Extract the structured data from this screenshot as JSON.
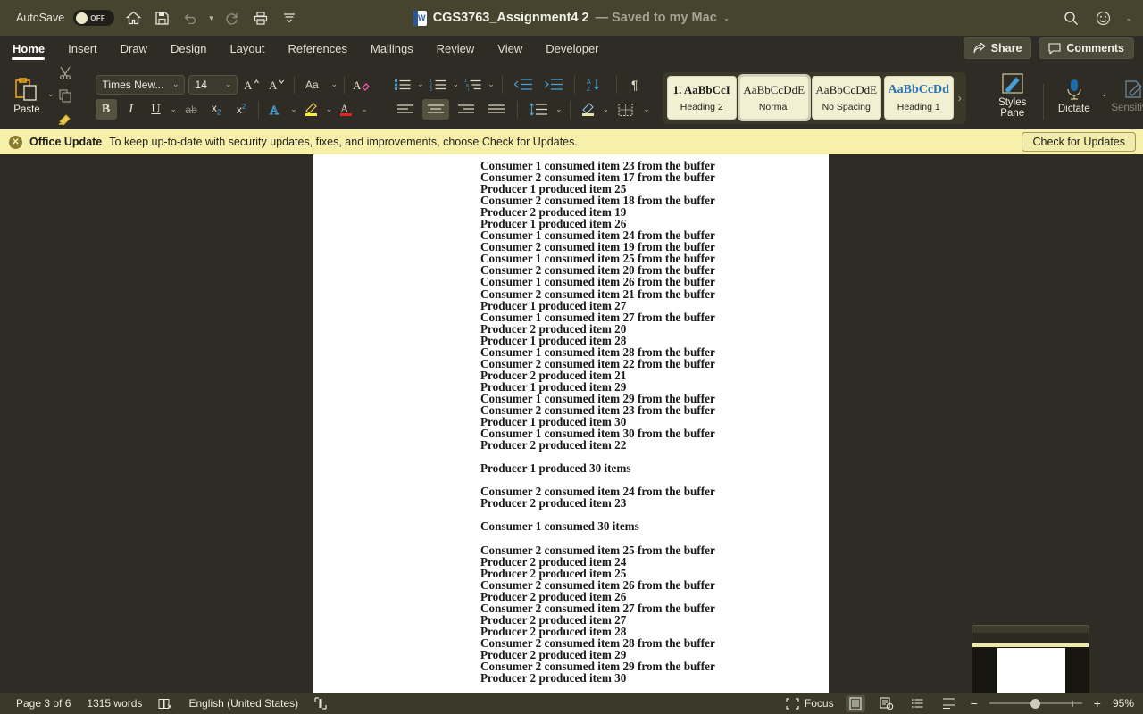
{
  "titlebar": {
    "autosave_label": "AutoSave",
    "autosave_state": "OFF",
    "doc_title": "CGS3763_Assignment4 2",
    "saved_state": "— Saved to my Mac",
    "icons": [
      "home-icon",
      "save-icon",
      "undo-icon",
      "redo-icon",
      "print-icon",
      "customize-toolbar-icon"
    ],
    "search_icon": "search-icon",
    "account_icon": "smiley-face-icon"
  },
  "tabs": [
    {
      "label": "Home",
      "active": true
    },
    {
      "label": "Insert",
      "active": false
    },
    {
      "label": "Draw",
      "active": false
    },
    {
      "label": "Design",
      "active": false
    },
    {
      "label": "Layout",
      "active": false
    },
    {
      "label": "References",
      "active": false
    },
    {
      "label": "Mailings",
      "active": false
    },
    {
      "label": "Review",
      "active": false
    },
    {
      "label": "View",
      "active": false
    },
    {
      "label": "Developer",
      "active": false
    }
  ],
  "tab_actions": {
    "share_label": "Share",
    "comments_label": "Comments"
  },
  "ribbon": {
    "paste_label": "Paste",
    "font_name": "Times New...",
    "font_size": "14",
    "bold_active": true,
    "align_center_active": true,
    "styles": [
      {
        "preview": "1.  AaBbCcI",
        "name": "Heading 2",
        "selected": false,
        "variant": "bold"
      },
      {
        "preview": "AaBbCcDdE",
        "name": "Normal",
        "selected": true,
        "variant": "plain"
      },
      {
        "preview": "AaBbCcDdE",
        "name": "No Spacing",
        "selected": false,
        "variant": "plain"
      },
      {
        "preview": "AaBbCcDd",
        "name": "Heading 1",
        "selected": false,
        "variant": "heading1"
      }
    ],
    "styles_pane_label": "Styles Pane",
    "dictate_label": "Dictate",
    "sensitivity_label": "Sensitivity"
  },
  "notice": {
    "title": "Office Update",
    "message": "To keep up-to-date with security updates, fixes, and improvements, choose Check for Updates.",
    "button_label": "Check for Updates",
    "close_icon": "close-icon",
    "background_color": "#f6f0ab"
  },
  "document": {
    "lines": [
      "Consumer 1 consumed item 23 from the buffer",
      "Consumer 2 consumed item 17 from the buffer",
      "Producer 1 produced item 25",
      "Consumer 2 consumed item 18 from the buffer",
      "Producer 2 produced item 19",
      "Producer 1 produced item 26",
      "Consumer 1 consumed item 24 from the buffer",
      "Consumer 2 consumed item 19 from the buffer",
      "Consumer 1 consumed item 25 from the buffer",
      "Consumer 2 consumed item 20 from the buffer",
      "Consumer 1 consumed item 26 from the buffer",
      "Consumer 2 consumed item 21 from the buffer",
      "Producer 1 produced item 27",
      "Consumer 1 consumed item 27 from the buffer",
      "Producer 2 produced item 20",
      "Producer 1 produced item 28",
      "Consumer 1 consumed item 28 from the buffer",
      "Consumer 2 consumed item 22 from the buffer",
      "Producer 2 produced item 21",
      "Producer 1 produced item 29",
      "Consumer 1 consumed item 29 from the buffer",
      "Consumer 2 consumed item 23 from the buffer",
      "Producer 1 produced item 30",
      "Consumer 1 consumed item 30 from the buffer",
      "Producer 2 produced item 22",
      "",
      "Producer 1 produced 30 items",
      "",
      "Consumer 2 consumed item 24 from the buffer",
      "Producer 2 produced item 23",
      "",
      "Consumer 1 consumed 30 items",
      "",
      "Consumer 2 consumed item 25 from the buffer",
      "Producer 2 produced item 24",
      "Producer 2 produced item 25",
      "Consumer 2 consumed item 26 from the buffer",
      "Producer 2 produced item 26",
      "Consumer 2 consumed item 27 from the buffer",
      "Producer 2 produced item 27",
      "Producer 2 produced item 28",
      "Consumer 2 consumed item 28 from the buffer",
      "Producer 2 produced item 29",
      "Consumer 2 consumed item 29 from the buffer",
      "Producer 2 produced item 30"
    ]
  },
  "status": {
    "page": "Page 3 of 6",
    "words": "1315 words",
    "proofing_icon": "proofing-errors-icon",
    "language": "English (United States)",
    "accessibility_icon": "accessibility-icon",
    "focus_label": "Focus",
    "zoom_level": "95%"
  }
}
